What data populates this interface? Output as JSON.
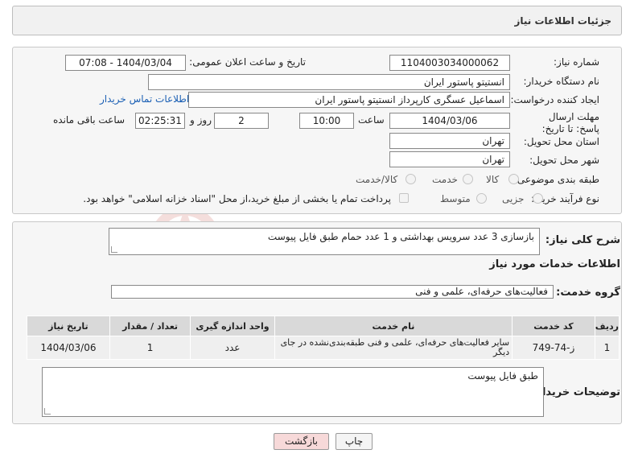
{
  "header": {
    "title": "جزئیات اطلاعات نیاز"
  },
  "form": {
    "need_number_label": "شماره نیاز:",
    "need_number": "1104003034000062",
    "announce_label": "تاریخ و ساعت اعلان عمومی:",
    "announce_value": "1404/03/04 - 07:08",
    "buyer_org_label": "نام دستگاه خریدار:",
    "buyer_org": "انستیتو پاستور ایران",
    "creator_label": "ایجاد کننده درخواست:",
    "creator": "اسماعیل عسگری کارپرداز انستیتو پاستور ایران",
    "contact_link": "اطلاعات تماس خریدار",
    "deadline_label": "مهلت ارسال پاسخ: تا تاریخ:",
    "deadline_date": "1404/03/06",
    "time_label": "ساعت",
    "deadline_time": "10:00",
    "days_value": "2",
    "days_label": "روز و",
    "remaining_time": "02:25:31",
    "remaining_label": "ساعت باقی مانده",
    "province_label": "استان محل تحویل:",
    "province": "تهران",
    "city_label": "شهر محل تحویل:",
    "city": "تهران",
    "category_label": "طبقه بندی موضوعی:",
    "category_options": [
      "کالا",
      "خدمت",
      "کالا/خدمت"
    ],
    "process_label": "نوع فرآیند خرید :",
    "process_options": [
      "جزیی",
      "متوسط"
    ],
    "payment_note": "پرداخت تمام یا بخشی از مبلغ خرید،از محل \"اسناد خزانه اسلامی\" خواهد بود."
  },
  "general": {
    "desc_label": "شرح کلی نیاز:",
    "desc_value": "بازسازی 3 عدد سرویس بهداشتی و 1 عدد حمام طبق فایل پیوست",
    "services_title": "اطلاعات خدمات مورد نیاز",
    "group_label": "گروه خدمت:",
    "group_value": "فعالیت‌های حرفه‌ای، علمی و فنی"
  },
  "table": {
    "headers": [
      "ردیف",
      "کد خدمت",
      "نام خدمت",
      "واحد اندازه گیری",
      "تعداد / مقدار",
      "تاریخ نیاز"
    ],
    "rows": [
      [
        "1",
        "ز-74-749",
        "سایر فعالیت‌های حرفه‌ای، علمی و فنی طبقه‌بندی‌نشده در جای دیگر",
        "عدد",
        "1",
        "1404/03/06"
      ]
    ]
  },
  "buyer_notes": {
    "label": "توضیحات خریدار:",
    "value": "طبق فایل پیوست"
  },
  "buttons": {
    "print": "چاپ",
    "back": "بازگشت"
  },
  "colors": {
    "accent_link": "#1a5fb4",
    "back_button": "#f7d9d9",
    "print_button": "#f4f4f4"
  }
}
